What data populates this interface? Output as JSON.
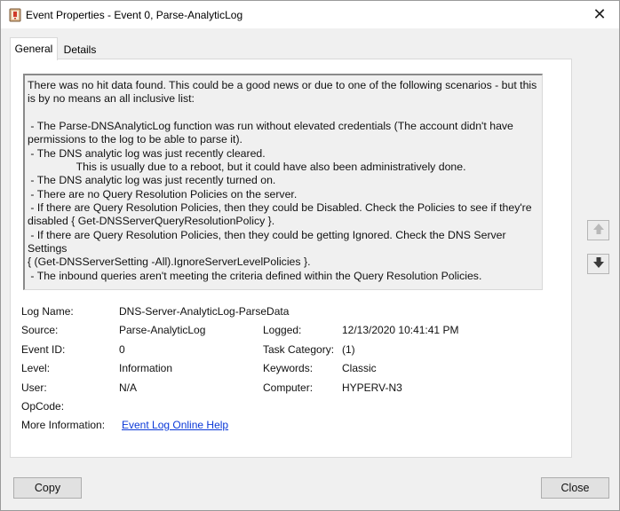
{
  "window": {
    "title": "Event Properties - Event 0, Parse-AnalyticLog",
    "close_glyph": "✕"
  },
  "tabs": [
    {
      "label": "General",
      "selected": true
    },
    {
      "label": "Details",
      "selected": false
    }
  ],
  "description": "There was no hit data found. This could be a good news or due to one of the following scenarios - but this\nis by no means an all inclusive list:\n\n - The Parse-DNSAnalyticLog function was run without elevated credentials (The account didn't have\npermissions to the log to be able to parse it).\n - The DNS analytic log was just recently cleared.\n                This is usually due to a reboot, but it could have also been administratively done.\n - The DNS analytic log was just recently turned on.\n - There are no Query Resolution Policies on the server.\n - If there are Query Resolution Policies, then they could be Disabled. Check the Policies to see if they're\ndisabled { Get-DNSServerQueryResolutionPolicy }.\n - If there are Query Resolution Policies, then they could be getting Ignored. Check the DNS Server Settings\n{ (Get-DNSServerSetting -All).IgnoreServerLevelPolicies }.\n - The inbound queries aren't meeting the criteria defined within the Query Resolution Policies.",
  "fields": {
    "log_name_label": "Log Name:",
    "log_name_value": "DNS-Server-AnalyticLog-ParseData",
    "source_label": "Source:",
    "source_value": "Parse-AnalyticLog",
    "logged_label": "Logged:",
    "logged_value": "12/13/2020 10:41:41 PM",
    "event_id_label": "Event ID:",
    "event_id_value": "0",
    "task_category_label": "Task Category:",
    "task_category_value": "(1)",
    "level_label": "Level:",
    "level_value": "Information",
    "keywords_label": "Keywords:",
    "keywords_value": "Classic",
    "user_label": "User:",
    "user_value": "N/A",
    "computer_label": "Computer:",
    "computer_value": "HYPERV-N3",
    "opcode_label": "OpCode:",
    "opcode_value": "",
    "more_info_label": "More Information:",
    "more_info_link": "Event Log Online Help"
  },
  "buttons": {
    "copy": "Copy",
    "close": "Close"
  },
  "icons": {
    "app": "event-viewer-icon",
    "up": "arrow-up-icon",
    "down": "arrow-down-icon"
  },
  "colors": {
    "link": "#0b39d8",
    "background": "#f0f0f0"
  }
}
